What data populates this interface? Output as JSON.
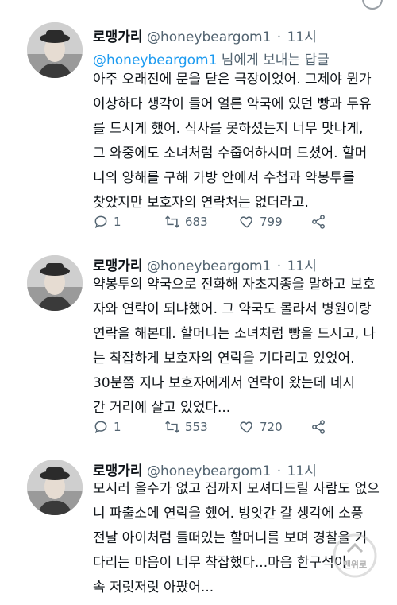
{
  "tweets": [
    {
      "name": "로맹가리",
      "handle": "@honeybeargom1",
      "separator": "·",
      "time": "11시",
      "reply_mention": "@honeybeargom1",
      "reply_suffix": " 님에게 보내는 답글",
      "lines": [
        "아주 오래전에 문을 닫은 극장이었어. 그제야 뭔가",
        "이상하다 생각이 들어 얼른 약국에 있던 빵과 두유",
        "를 드시게 했어. 식사를 못하셨는지 너무 맛나게,",
        "그 와중에도 소녀처럼 수줍어하시며 드셨어. 할머",
        "니의 양해를 구해 가방 안에서 수첩과 약봉투를",
        "찾았지만 보호자의 연락처는 없더라고."
      ],
      "replies": "1",
      "retweets": "683",
      "likes": "799"
    },
    {
      "name": "로맹가리",
      "handle": "@honeybeargom1",
      "separator": "·",
      "time": "11시",
      "lines": [
        "약봉투의 약국으로 전화해 자초지종을 말하고 보호",
        "자와 연락이 되냐했어. 그 약국도 몰라서 병원이랑",
        "연락을 해본대. 할머니는 소녀처럼 빵을 드시고, 나",
        "는 착잡하게 보호자의 연락을 기다리고 있었어.",
        "30분쯤 지나 보호자에게서 연락이 왔는데 네시",
        "간 거리에 살고 있었다..."
      ],
      "replies": "1",
      "retweets": "553",
      "likes": "720"
    },
    {
      "name": "로맹가리",
      "handle": "@honeybeargom1",
      "separator": "·",
      "time": "11시",
      "lines": [
        "모시러 올수가 없고 집까지 모셔다드릴 사람도 없으",
        "니 파출소에 연락을 했어. 방앗간 갈 생각에 소풍",
        "전날 아이처럼 들떠있는 할머니를 보며 경찰을 기",
        "다리는 마음이 너무 착잡했다...마음 한구석이",
        "속 저릿저릿 아팠어..."
      ]
    }
  ],
  "watermark": "맨위로",
  "colors": {
    "text": "#0f1419",
    "secondary": "#536471",
    "link": "#1d9bf0",
    "divider": "#eff3f4"
  },
  "icons": {
    "reply": "reply-icon",
    "retweet": "retweet-icon",
    "like": "heart-icon",
    "share": "share-icon"
  }
}
